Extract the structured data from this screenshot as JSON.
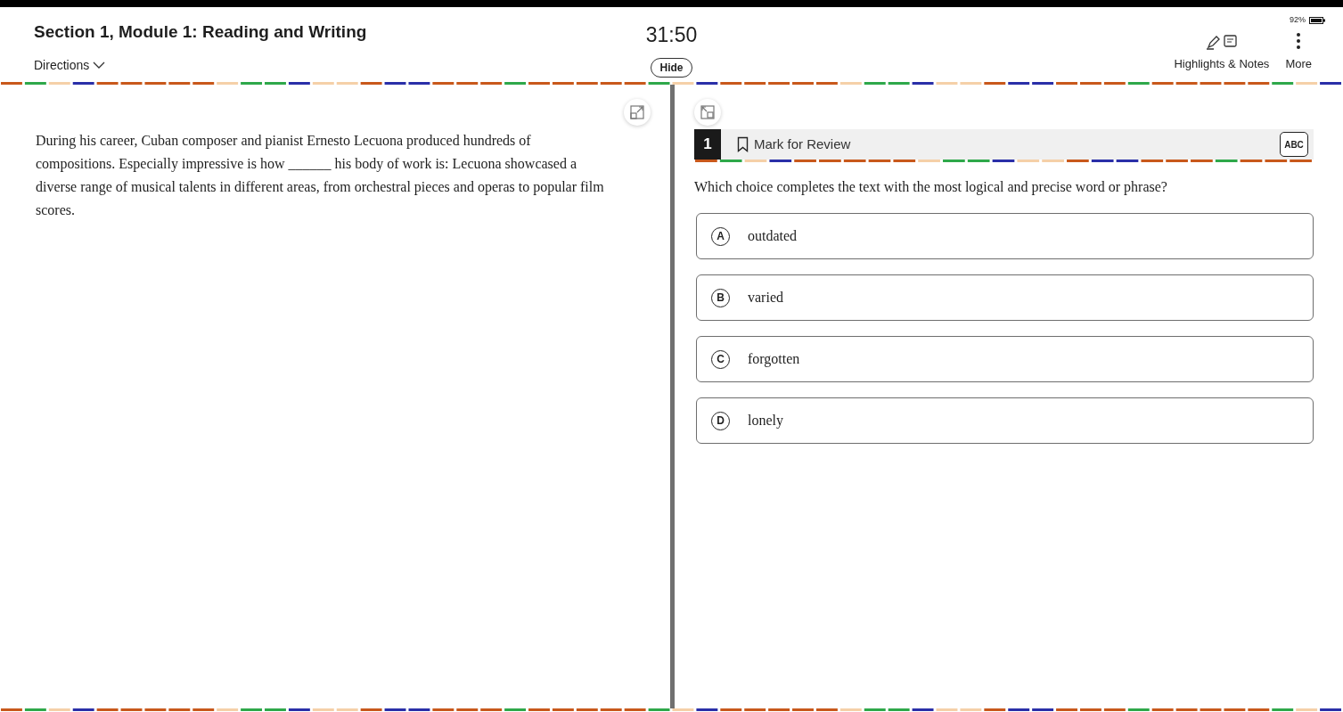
{
  "header": {
    "section_title": "Section 1, Module 1: Reading and Writing",
    "directions": "Directions",
    "timer": "31:50",
    "hide_button": "Hide",
    "battery": "92%",
    "tools": [
      {
        "label": "Highlights & Notes",
        "kind": "notes"
      },
      {
        "label": "More",
        "kind": "more"
      }
    ]
  },
  "passage": {
    "text": "During his career, Cuban composer and pianist Ernesto Lecuona produced hundreds of compositions. Especially impressive is how ______ his body of work is: Lecuona showcased a diverse range of musical talents in different areas, from orchestral pieces and operas to popular film scores."
  },
  "question": {
    "number": "1",
    "mark_for_review": "Mark for Review",
    "marked": false,
    "eliminator": "ABC",
    "prompt": "Which choice completes the text with the most logical and precise word or phrase?",
    "choices": [
      {
        "letter": "A",
        "text": "outdated",
        "selected": false
      },
      {
        "letter": "B",
        "text": "varied",
        "selected": false
      },
      {
        "letter": "C",
        "text": "forgotten",
        "selected": false
      },
      {
        "letter": "D",
        "text": "lonely",
        "selected": false
      }
    ]
  }
}
